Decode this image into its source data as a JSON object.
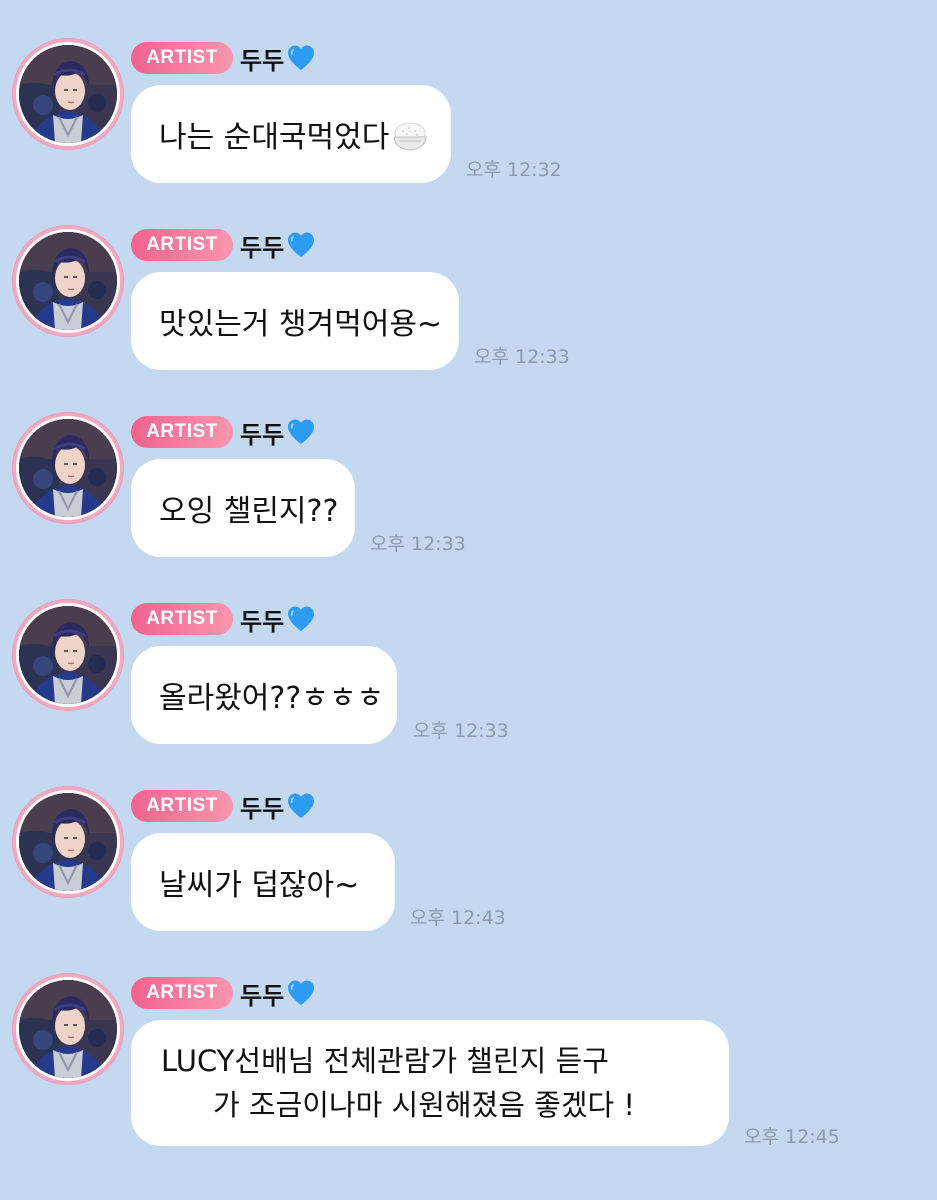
{
  "colors": {
    "background": "#c4d9ef",
    "bubble": "#ffffff",
    "badge_start": "#f0638e",
    "badge_end": "#fb96ae",
    "timestamp": "#8c9aab",
    "heart": "#2e9cf2"
  },
  "messages": [
    {
      "badge": "ARTIST",
      "sender": "두두",
      "heart_icon": "blue-heart-icon",
      "text": "나는 순대국먹었다",
      "emoji_icon": "rice-bowl-icon",
      "time": "오후 12:32"
    },
    {
      "badge": "ARTIST",
      "sender": "두두",
      "heart_icon": "blue-heart-icon",
      "text": "맛있는거 챙겨먹어용~",
      "time": "오후 12:33"
    },
    {
      "badge": "ARTIST",
      "sender": "두두",
      "heart_icon": "blue-heart-icon",
      "text": "오잉 챌린지??",
      "time": "오후 12:33"
    },
    {
      "badge": "ARTIST",
      "sender": "두두",
      "heart_icon": "blue-heart-icon",
      "text": "올라왔어??ㅎㅎㅎ",
      "time": "오후 12:33"
    },
    {
      "badge": "ARTIST",
      "sender": "두두",
      "heart_icon": "blue-heart-icon",
      "text": "날씨가 덥잖아~",
      "time": "오후 12:43"
    },
    {
      "badge": "ARTIST",
      "sender": "두두",
      "heart_icon": "blue-heart-icon",
      "text_line1": "LUCY선배님 전체관람가 챌린지 듣구",
      "text_line2": "가 조금이나마 시원해졌음 좋겠다 !",
      "time": "오후 12:45"
    }
  ]
}
